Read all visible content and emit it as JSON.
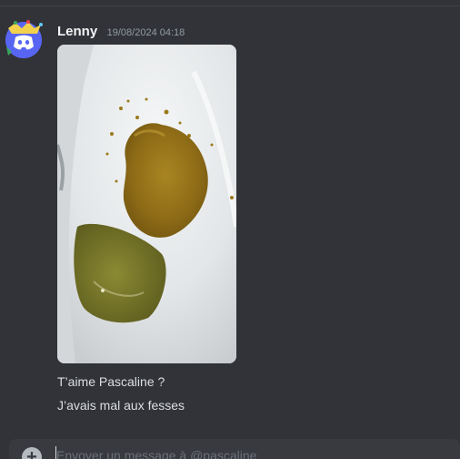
{
  "message": {
    "author": "Lenny",
    "timestamp": "19/08/2024 04:18",
    "attachment_alt": "",
    "lines": [
      "T’aime Pascaline ?",
      "J’avais mal aux fesses"
    ]
  },
  "composer": {
    "placeholder": "Envoyer un message à @pascaline",
    "add_icon": "plus-circle-icon"
  },
  "colors": {
    "background": "#313338",
    "composer": "#383a40",
    "username": "#f2f3f5",
    "timestamp": "#949ba4",
    "text": "#dbdee1",
    "avatar": "#5865f2"
  }
}
